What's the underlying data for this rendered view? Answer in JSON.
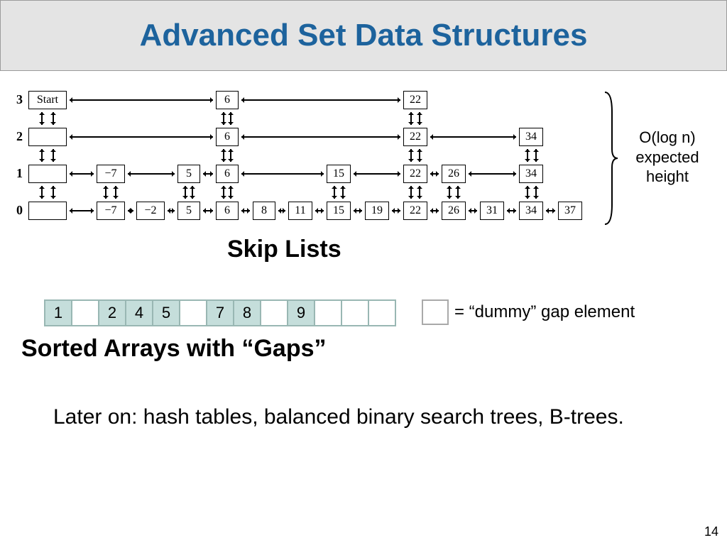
{
  "title": "Advanced Set Data Structures",
  "skip": {
    "levels": [
      "3",
      "2",
      "1",
      "0"
    ],
    "nodes": {
      "start": "Start",
      "n_7": "−7",
      "n_2": "−2",
      "5": "5",
      "6": "6",
      "8": "8",
      "11": "11",
      "15": "15",
      "19": "19",
      "22": "22",
      "26": "26",
      "31": "31",
      "34": "34",
      "37": "37"
    }
  },
  "brace_label": "O(log n) expected height",
  "subtitle_skip": "Skip Lists",
  "gaps": {
    "cells": [
      "1",
      "",
      "2",
      "4",
      "5",
      "",
      "7",
      "8",
      "",
      "9",
      "",
      "",
      ""
    ],
    "legend": "= “dummy” gap element"
  },
  "subtitle_gaps": "Sorted Arrays with “Gaps”",
  "later": "Later on: hash tables, balanced binary search trees, B-trees.",
  "page_number": "14"
}
